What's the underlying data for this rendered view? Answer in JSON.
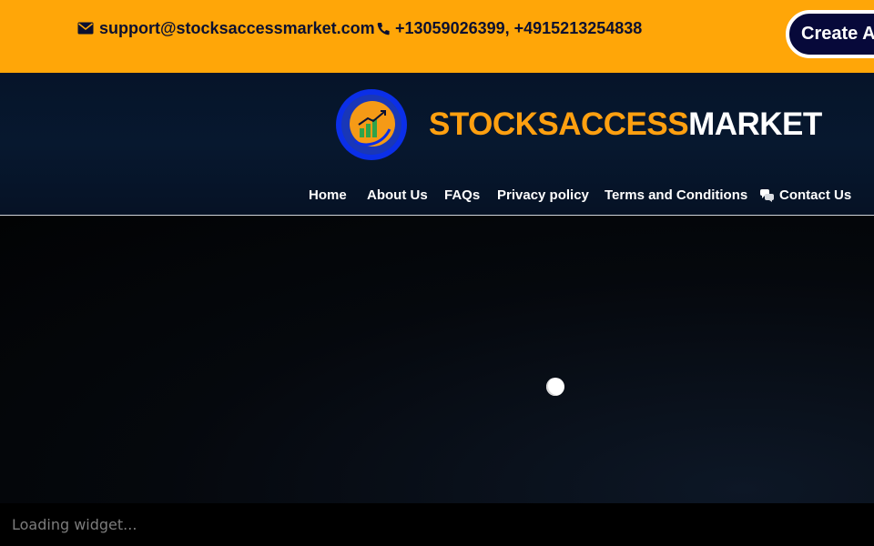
{
  "topbar": {
    "email": "support@stocksaccessmarket.com",
    "phones": "+13059026399, +4915213254838",
    "create_account_label": "Create Ac",
    "icons": {
      "email": "envelope-icon",
      "phone": "phone-icon"
    }
  },
  "header": {
    "brand_accent": "STOCKSACCESS",
    "brand_rest": "MARKET",
    "logo_icon": "growth-chart-logo-icon"
  },
  "nav": {
    "items": [
      "Home",
      "About Us",
      "FAQs",
      "Privacy policy",
      "Terms and Conditions",
      "Contact Us"
    ],
    "contact_icon": "chat-bubbles-icon"
  },
  "hero": {
    "loading_text": "Loading widget..."
  },
  "colors": {
    "topbar": "#ffa608",
    "header": "#061429",
    "brand_accent": "#ffa010",
    "button_bg": "#07093a"
  }
}
